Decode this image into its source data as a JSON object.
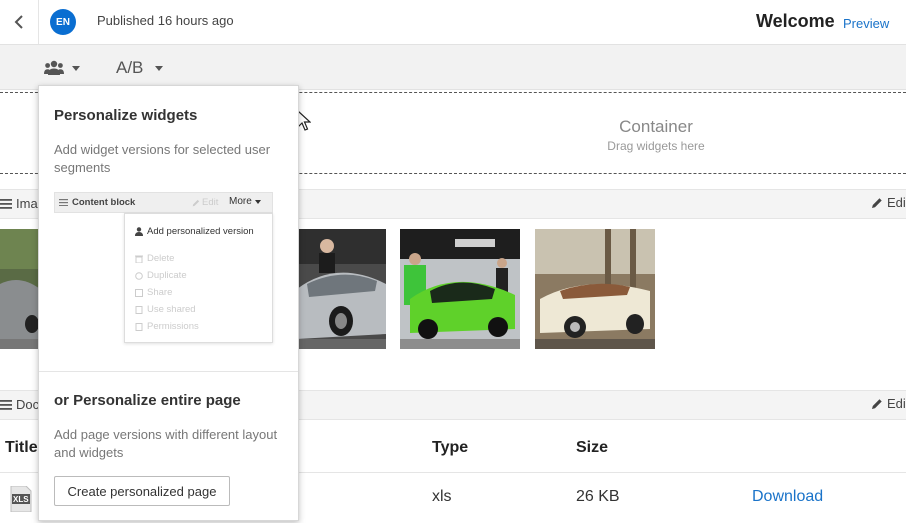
{
  "header": {
    "avatar_initials": "EN",
    "published_text": "Published 16 hours ago",
    "page_title": "Welcome",
    "preview_label": "Preview"
  },
  "toolbar": {
    "ab_label": "A/B"
  },
  "container": {
    "label": "Container",
    "hint": "Drag widgets here"
  },
  "sections": {
    "images_title": "Ima",
    "documents_title": "Doc",
    "edit_label": "Edi"
  },
  "documents_table": {
    "headers": [
      "Title",
      "Type",
      "Size"
    ],
    "rows": [
      {
        "file_badge": "XLS",
        "type": "xls",
        "size": "26 KB",
        "action": "Download"
      }
    ]
  },
  "popover": {
    "heading1": "Personalize widgets",
    "desc1": "Add widget versions for selected user segments",
    "mini_block_label": "Content block",
    "mini_edit": "Edit",
    "mini_more": "More",
    "mini_menu": {
      "add": "Add personalized version",
      "items": [
        "Delete",
        "Duplicate",
        "Share",
        "Use shared",
        "Permissions"
      ]
    },
    "heading2": "or Personalize entire page",
    "desc2": "Add page versions with different layout and widgets",
    "button_label": "Create personalized page"
  },
  "colors": {
    "accent": "#1a73c9",
    "avatar": "#0a6ed1",
    "car_green": "#5fd12a"
  }
}
